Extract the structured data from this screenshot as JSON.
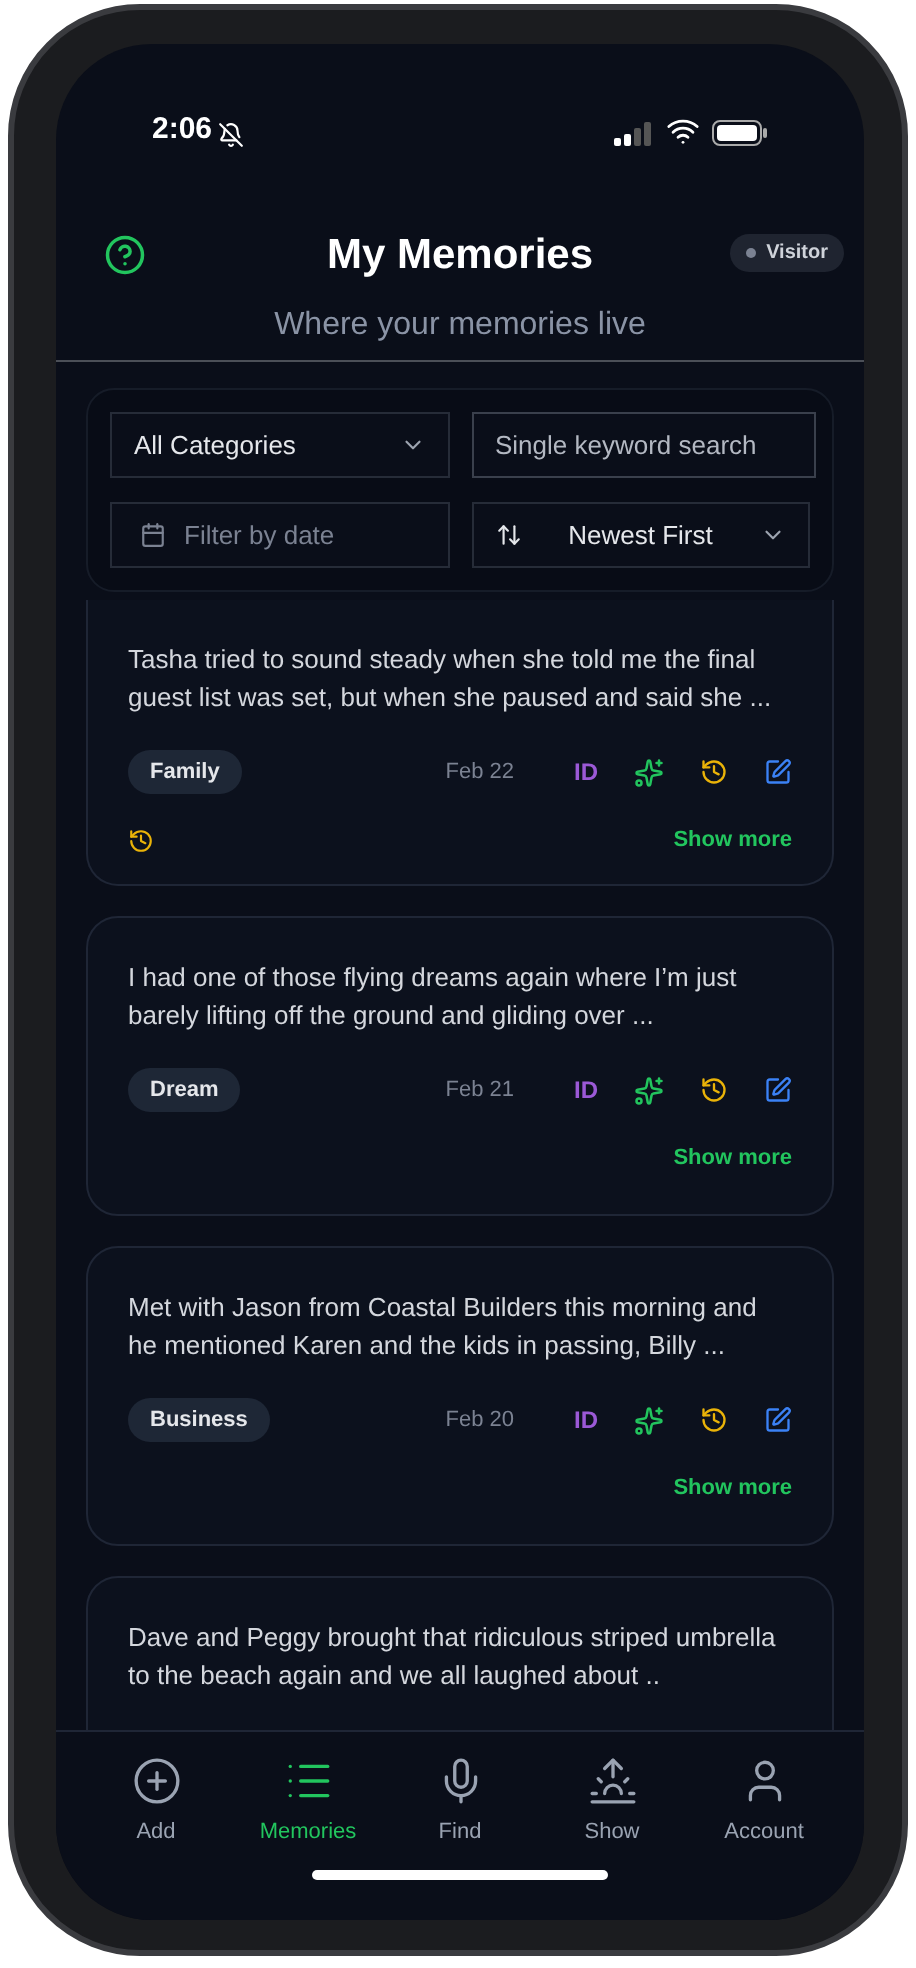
{
  "status_bar": {
    "time": "2:06"
  },
  "header": {
    "title": "My Memories",
    "subtitle": "Where your memories live",
    "badge": "Visitor"
  },
  "filters": {
    "category": "All Categories",
    "search_placeholder": "Single keyword search",
    "date_placeholder": "Filter by date",
    "sort": "Newest First"
  },
  "cards": [
    {
      "text": "Tasha tried to sound steady when she told me the final guest list was set, but when she paused and said she ...",
      "category": "Family",
      "date": "Feb 22",
      "id_label": "ID",
      "history_badge": true,
      "show_more": "Show more"
    },
    {
      "text": "I had one of those flying dreams again where I’m just barely lifting off the ground and gliding over ...",
      "category": "Dream",
      "date": "Feb 21",
      "id_label": "ID",
      "history_badge": false,
      "show_more": "Show more"
    },
    {
      "text": "Met with Jason from Coastal Builders this morning and he mentioned Karen and the kids in passing, Billy ...",
      "category": "Business",
      "date": "Feb 20",
      "id_label": "ID",
      "history_badge": false,
      "show_more": "Show more"
    },
    {
      "text": "Dave and Peggy brought that ridiculous striped umbrella to the beach again and we all laughed about .."
    }
  ],
  "nav": [
    {
      "kind": "add",
      "label": "Add",
      "selected": false
    },
    {
      "kind": "list",
      "label": "Memories",
      "selected": true
    },
    {
      "kind": "mic",
      "label": "Find",
      "selected": false
    },
    {
      "kind": "sunrise",
      "label": "Show",
      "selected": false
    },
    {
      "kind": "user",
      "label": "Account",
      "selected": false
    }
  ]
}
